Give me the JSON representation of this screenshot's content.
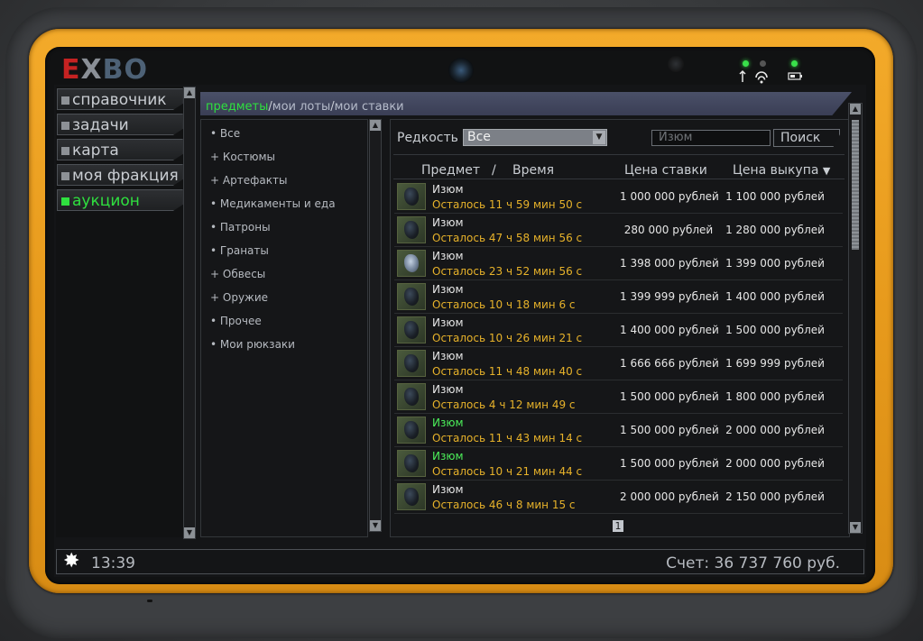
{
  "device": {
    "logo": {
      "e": "E",
      "x": "X",
      "rest": "BO"
    },
    "icons": [
      "wifi-icon",
      "battery-icon"
    ]
  },
  "nav": {
    "items": [
      {
        "label": "справочник",
        "active": false
      },
      {
        "label": "задачи",
        "active": false
      },
      {
        "label": "карта",
        "active": false
      },
      {
        "label": "моя фракция",
        "active": false
      },
      {
        "label": "аукцион",
        "active": true
      }
    ]
  },
  "breadcrumb": {
    "active": "предметы",
    "sep": "/",
    "lots": "мои лоты",
    "bids": "мои ставки"
  },
  "categories": [
    {
      "prefix": "•",
      "label": "Все"
    },
    {
      "prefix": "+",
      "label": "Костюмы"
    },
    {
      "prefix": "+",
      "label": "Артефакты"
    },
    {
      "prefix": "•",
      "label": "Медикаменты и еда"
    },
    {
      "prefix": "•",
      "label": "Патроны"
    },
    {
      "prefix": "•",
      "label": "Гранаты"
    },
    {
      "prefix": "+",
      "label": "Обвесы"
    },
    {
      "prefix": "+",
      "label": "Оружие"
    },
    {
      "prefix": "•",
      "label": "Прочее"
    },
    {
      "prefix": "•",
      "label": "Мои рюкзаки"
    }
  ],
  "filter": {
    "rarity_label": "Редкость",
    "rarity_value": "Все",
    "search_placeholder": "Изюм",
    "search_button": "Поиск"
  },
  "table": {
    "col_item": "Предмет",
    "col_sep": "/",
    "col_time": "Время",
    "col_bid": "Цена ставки",
    "col_buyout": "Цена выкупа",
    "sort_indicator": "▼",
    "rows": [
      {
        "name": "Изюм",
        "name_color": "white",
        "time": "Осталось 11 ч 59 мин 50 с",
        "bid": "1 000 000 рублей",
        "buyout": "1 100 000 рублей",
        "icon": "artifact-dark-icon"
      },
      {
        "name": "Изюм",
        "name_color": "white",
        "time": "Осталось 47 ч 58 мин 56 с",
        "bid": "280 000 рублей",
        "buyout": "1 280 000 рублей",
        "icon": "artifact-dark-icon"
      },
      {
        "name": "Изюм",
        "name_color": "white",
        "time": "Осталось 23 ч 52 мин 56 с",
        "bid": "1 398 000 рублей",
        "buyout": "1 399 000 рублей",
        "icon": "artifact-light-icon"
      },
      {
        "name": "Изюм",
        "name_color": "white",
        "time": "Осталось 10 ч 18 мин 6 с",
        "bid": "1 399 999 рублей",
        "buyout": "1 400 000 рублей",
        "icon": "artifact-dark-icon"
      },
      {
        "name": "Изюм",
        "name_color": "white",
        "time": "Осталось 10 ч 26 мин 21 с",
        "bid": "1 400 000 рублей",
        "buyout": "1 500 000 рублей",
        "icon": "artifact-dark-icon"
      },
      {
        "name": "Изюм",
        "name_color": "white",
        "time": "Осталось 11 ч 48 мин 40 с",
        "bid": "1 666 666 рублей",
        "buyout": "1 699 999 рублей",
        "icon": "artifact-dark-icon"
      },
      {
        "name": "Изюм",
        "name_color": "white",
        "time": "Осталось 4 ч 12 мин 49 с",
        "bid": "1 500 000 рублей",
        "buyout": "1 800 000 рублей",
        "icon": "artifact-dark-icon"
      },
      {
        "name": "Изюм",
        "name_color": "green",
        "time": "Осталось 11 ч 43 мин 14 с",
        "bid": "1 500 000 рублей",
        "buyout": "2 000 000 рублей",
        "icon": "artifact-dark-icon"
      },
      {
        "name": "Изюм",
        "name_color": "green",
        "time": "Осталось 10 ч 21 мин 44 с",
        "bid": "1 500 000 рублей",
        "buyout": "2 000 000 рублей",
        "icon": "artifact-dark-icon"
      },
      {
        "name": "Изюм",
        "name_color": "white",
        "time": "Осталось 46 ч 8 мин 15 с",
        "bid": "2 000 000 рублей",
        "buyout": "2 150 000 рублей",
        "icon": "artifact-dark-icon"
      }
    ],
    "page": "1"
  },
  "status": {
    "icon": "sun-icon",
    "time": "13:39",
    "balance": "Счет: 36 737 760 руб."
  },
  "colors": {
    "active": "#2fe03f",
    "timer": "#e7b22a",
    "bezel": "#e79a1c"
  }
}
